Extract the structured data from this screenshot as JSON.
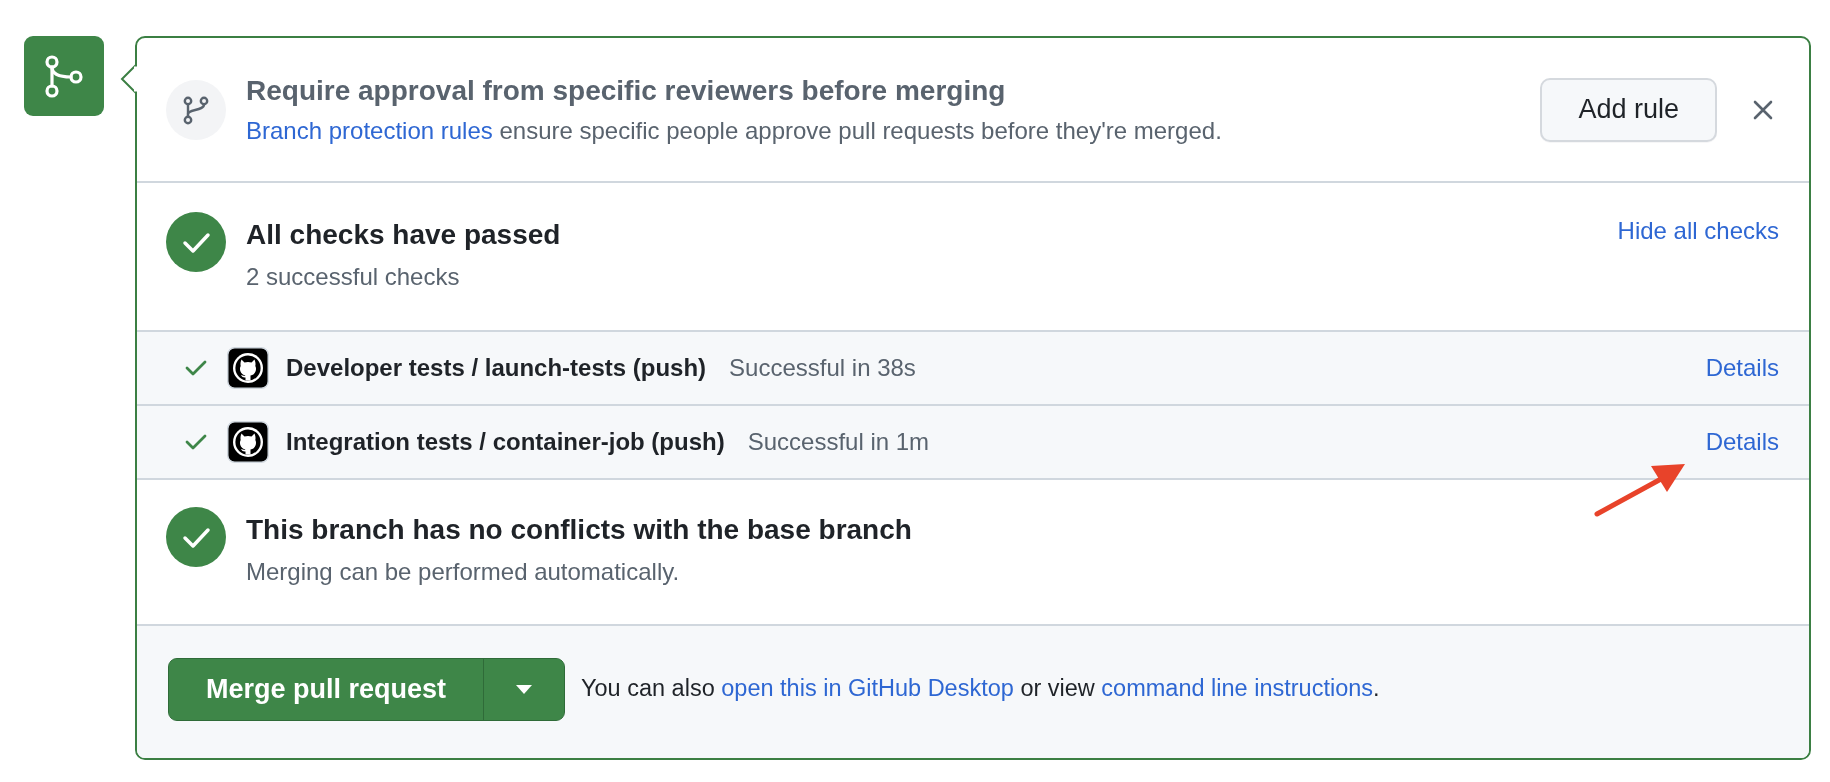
{
  "approval": {
    "title": "Require approval from specific reviewers before merging",
    "description": [
      {
        "kind": "link",
        "text": "Branch protection rules"
      },
      {
        "kind": "text",
        "text": " ensure specific people approve pull requests before they're merged."
      }
    ],
    "button": "Add rule"
  },
  "checks_summary": {
    "passed": true,
    "title": "All checks have passed",
    "subtitle": "2 successful checks",
    "toggle": "Hide all checks"
  },
  "checks": [
    {
      "passed": true,
      "name": "Developer tests / launch-tests (push)",
      "status": "Successful in 38s",
      "link": "Details"
    },
    {
      "passed": true,
      "name": "Integration tests / container-job (push)",
      "status": "Successful in 1m",
      "link": "Details"
    }
  ],
  "merge_status": {
    "passed": true,
    "title": "This branch has no conflicts with the base branch",
    "subtitle": "Merging can be performed automatically."
  },
  "merge": {
    "button": "Merge pull request",
    "hint": [
      {
        "kind": "text",
        "text": "You can also "
      },
      {
        "kind": "link",
        "text": "open this in GitHub Desktop"
      },
      {
        "kind": "text",
        "text": " or view "
      },
      {
        "kind": "link",
        "text": "command line instructions"
      },
      {
        "kind": "text",
        "text": "."
      }
    ]
  }
}
